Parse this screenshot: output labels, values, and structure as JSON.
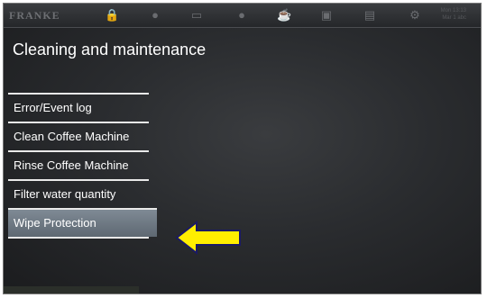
{
  "topbar": {
    "logo": "FRANKE",
    "icons": [
      "lock-icon",
      "coffee-bean-icon",
      "milk-icon",
      "water-drop-icon",
      "coffee-cup-icon",
      "machine-icon",
      "document-icon",
      "wrench-icon"
    ],
    "datetime_line1": "Mon 13:13",
    "datetime_line2": "Mar 1 abc"
  },
  "page": {
    "title": "Cleaning and maintenance"
  },
  "menu": {
    "items": [
      {
        "label": "Error/Event log"
      },
      {
        "label": "Clean Coffee Machine"
      },
      {
        "label": "Rinse Coffee Machine"
      },
      {
        "label": "Filter water quantity"
      },
      {
        "label": "Wipe Protection",
        "selected": true
      }
    ]
  },
  "annotation": {
    "arrow_color": "#ffee00",
    "arrow_stroke": "#1a1a66"
  }
}
